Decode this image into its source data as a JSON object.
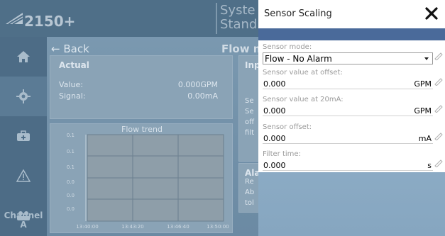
{
  "app": {
    "logo_text": "2150+",
    "system_line1": "Syste",
    "system_line2": "Stand",
    "back_label": "Back",
    "page_title": "Flow m",
    "channel_line1": "Channel",
    "channel_line2": "A"
  },
  "sidebar": {
    "items": [
      {
        "icon": "home-icon"
      },
      {
        "icon": "gear-icon"
      },
      {
        "icon": "toolbox-icon"
      },
      {
        "icon": "warning-icon"
      },
      {
        "icon": "users-icon"
      }
    ]
  },
  "actual": {
    "title": "Actual",
    "value_label": "Value:",
    "value": "0.000GPM",
    "signal_label": "Signal:",
    "signal": "0.00mA"
  },
  "inputs_partial": {
    "title": "Inp",
    "lines": [
      "Se",
      "Se",
      "off",
      "filt"
    ]
  },
  "alarm_partial": {
    "title": "Ala",
    "lines": [
      "Re",
      "Ab",
      "tol"
    ]
  },
  "trend": {
    "title": "Flow trend",
    "y_ticks": [
      "0.1",
      "0.1",
      "0.1",
      "0.0",
      "0.0",
      "0.0"
    ],
    "x_ticks": [
      "13:40:00",
      "13:43:20",
      "13:46:40",
      "13:50:00"
    ]
  },
  "dialog": {
    "title": "Sensor Scaling",
    "fields": [
      {
        "label": "Sensor mode:",
        "value": "Flow - No Alarm",
        "unit": ""
      },
      {
        "label": "Sensor value at offset:",
        "value": "0.000",
        "unit": "GPM"
      },
      {
        "label": "Sensor value at 20mA:",
        "value": "0.000",
        "unit": "GPM"
      },
      {
        "label": "Sensor offset:",
        "value": "0.000",
        "unit": "mA"
      },
      {
        "label": "Filter time:",
        "value": "0.000",
        "unit": "s"
      }
    ]
  },
  "colors": {
    "dialog_band": "#4a6a9a",
    "overlay": "#7d9bb2",
    "sidebar": "#4d6c86"
  }
}
